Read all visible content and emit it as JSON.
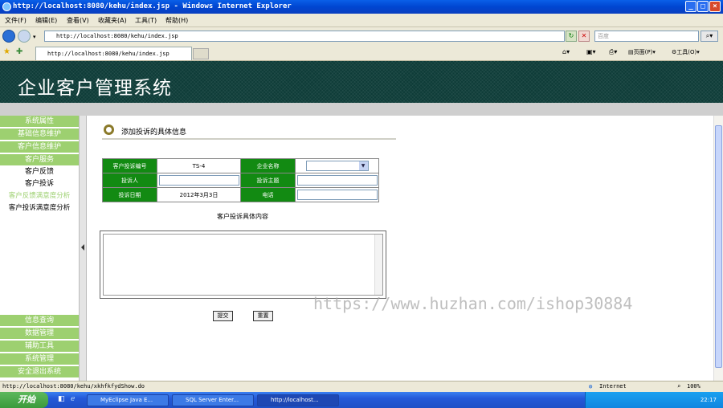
{
  "window": {
    "title": "http://localhost:8080/kehu/index.jsp - Windows Internet Explorer"
  },
  "menu": [
    "文件(F)",
    "编辑(E)",
    "查看(V)",
    "收藏夹(A)",
    "工具(T)",
    "帮助(H)"
  ],
  "address": {
    "url": "http://localhost:8080/kehu/index.jsp",
    "search_placeholder": "百度"
  },
  "tab": {
    "label": "http://localhost:8080/kehu/index.jsp"
  },
  "toolbar": {
    "page_label": "页面(P)",
    "tools_label": "工具(O)"
  },
  "app": {
    "title": "企业客户管理系统"
  },
  "sidebar": {
    "top_heads": [
      "系统属性",
      "基础信息维护",
      "客户信息维护",
      "客户服务"
    ],
    "subitems": [
      "客户反馈",
      "客户投诉",
      "客户反馈满意度分析",
      "客户投诉满意度分析"
    ],
    "bottom_heads": [
      "信息查询",
      "数据管理",
      "辅助工具",
      "系统管理",
      "安全退出系统"
    ]
  },
  "form": {
    "section_title": "添加投诉的具体信息",
    "complaint_no_label": "客户投诉编号",
    "complaint_no_value": "TS-4",
    "company_label": "企业名称",
    "complainant_label": "投诉人",
    "subject_label": "投诉主题",
    "date_label": "投诉日期",
    "date_value": "2012年3月3日",
    "phone_label": "电话",
    "detail_label": "客户投诉具体内容",
    "submit_label": "提交",
    "reset_label": "重置"
  },
  "watermark": "https://www.huzhan.com/ishop30884",
  "status": {
    "url": "http://localhost:8080/kehu/xkhfkfydShow.do",
    "zone": "Internet",
    "zoom": "100%"
  },
  "taskbar": {
    "start": "开始",
    "tasks": [
      "MyEclipse Java E...",
      "SQL Server Enter...",
      "http://localhost..."
    ],
    "clock": "22:17"
  },
  "colors": {
    "banner": "#0e3c38",
    "sidebar_head": "#9dd070",
    "form_label": "#128a12"
  }
}
